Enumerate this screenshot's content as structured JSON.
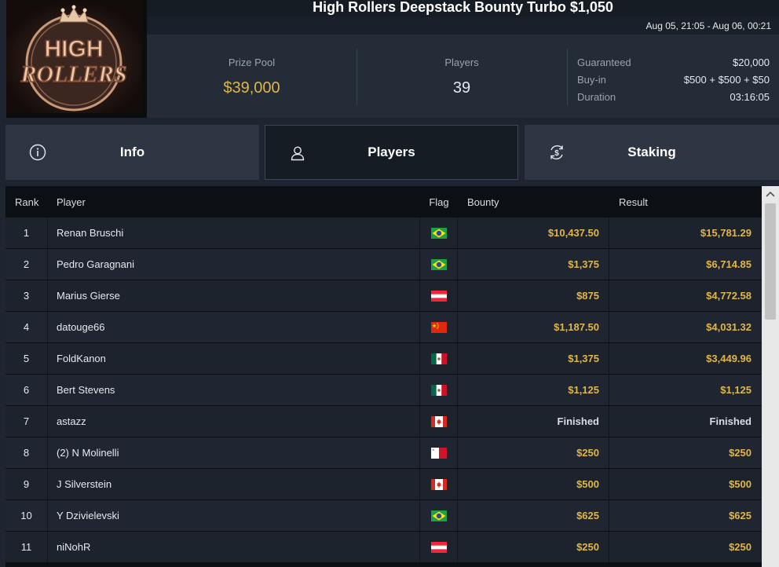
{
  "header": {
    "title": "High Rollers Deepstack Bounty Turbo $1,050",
    "dates": "Aug 05, 21:05 - Aug 06, 00:21",
    "logo_text_top": "HIGH",
    "logo_text_bottom": "ROLLERS"
  },
  "stats": {
    "prize_pool_label": "Prize Pool",
    "prize_pool_value": "$39,000",
    "players_label": "Players",
    "players_value": "39",
    "details": [
      {
        "key": "Guaranteed",
        "value": "$20,000"
      },
      {
        "key": "Buy-in",
        "value": "$500 + $500 + $50"
      },
      {
        "key": "Duration",
        "value": "03:16:05"
      }
    ]
  },
  "tabs": [
    {
      "label": "Info",
      "icon": "info-icon"
    },
    {
      "label": "Players",
      "icon": "user-icon"
    },
    {
      "label": "Staking",
      "icon": "dollar-cycle-icon"
    }
  ],
  "table": {
    "headers": {
      "rank": "Rank",
      "player": "Player",
      "flag": "Flag",
      "bounty": "Bounty",
      "result": "Result"
    },
    "rows": [
      {
        "rank": "1",
        "player": "Renan Bruschi",
        "flag": "brazil",
        "bounty": "$10,437.50",
        "result": "$15,781.29"
      },
      {
        "rank": "2",
        "player": "Pedro Garagnani",
        "flag": "brazil",
        "bounty": "$1,375",
        "result": "$6,714.85"
      },
      {
        "rank": "3",
        "player": "Marius Gierse",
        "flag": "austria",
        "bounty": "$875",
        "result": "$4,772.58"
      },
      {
        "rank": "4",
        "player": "datouge66",
        "flag": "china",
        "bounty": "$1,187.50",
        "result": "$4,031.32"
      },
      {
        "rank": "5",
        "player": "FoldKanon",
        "flag": "mexico",
        "bounty": "$1,375",
        "result": "$3,449.96"
      },
      {
        "rank": "6",
        "player": "Bert Stevens",
        "flag": "mexico",
        "bounty": "$1,125",
        "result": "$1,125"
      },
      {
        "rank": "7",
        "player": "astazz",
        "flag": "canada",
        "bounty": "Finished",
        "result": "Finished"
      },
      {
        "rank": "8",
        "player": "(2) N Molinelli",
        "flag": "malta",
        "bounty": "$250",
        "result": "$250"
      },
      {
        "rank": "9",
        "player": "J Silverstein",
        "flag": "canada",
        "bounty": "$500",
        "result": "$500"
      },
      {
        "rank": "10",
        "player": "Y Dzivielevski",
        "flag": "brazil",
        "bounty": "$625",
        "result": "$625"
      },
      {
        "rank": "11",
        "player": "niNohR",
        "flag": "austria",
        "bounty": "$250",
        "result": "$250"
      }
    ]
  },
  "colors": {
    "accent_gold": "#e0b64a",
    "background": "#1e2530",
    "table_bg": "#0c0f14"
  }
}
